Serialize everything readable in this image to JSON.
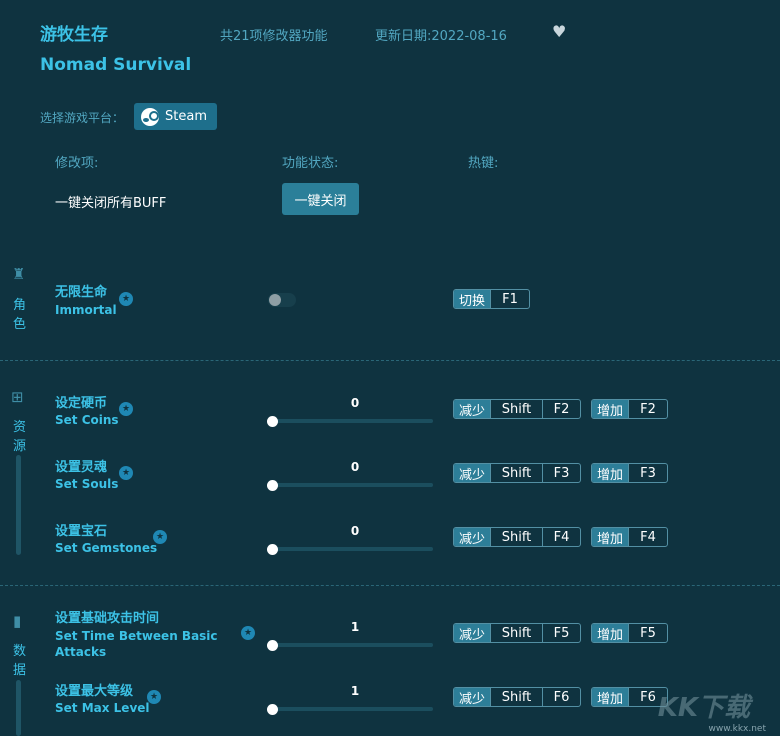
{
  "header": {
    "title_cn": "游牧生存",
    "title_en": "Nomad Survival",
    "feature_count": "共21项修改器功能",
    "update_date": "更新日期:2022-08-16",
    "heart": "♥"
  },
  "platform": {
    "label": "选择游戏平台：",
    "steam_label": "Steam"
  },
  "columns": {
    "option": "修改项:",
    "status": "功能状态:",
    "hotkey": "热键:"
  },
  "buff": {
    "label": "一键关闭所有BUFF",
    "button": "一键关闭"
  },
  "sections": {
    "role": {
      "icon": "♜",
      "char1": "角",
      "char2": "色"
    },
    "resource": {
      "icon": "⊞",
      "char1": "资",
      "char2": "源"
    },
    "data": {
      "icon": "▮",
      "char1": "数",
      "char2": "据"
    }
  },
  "options": {
    "immortal": {
      "cn": "无限生命",
      "en": "Immortal",
      "action": "切换",
      "key": "F1",
      "toggle_on": false
    },
    "coins": {
      "cn": "设定硬币",
      "en": "Set Coins",
      "value": "0",
      "dec": "减少",
      "mod": "Shift",
      "dec_key": "F2",
      "inc": "增加",
      "inc_key": "F2"
    },
    "souls": {
      "cn": "设置灵魂",
      "en": "Set Souls",
      "value": "0",
      "dec": "减少",
      "mod": "Shift",
      "dec_key": "F3",
      "inc": "增加",
      "inc_key": "F3"
    },
    "gems": {
      "cn": "设置宝石",
      "en": "Set Gemstones",
      "value": "0",
      "dec": "减少",
      "mod": "Shift",
      "dec_key": "F4",
      "inc": "增加",
      "inc_key": "F4"
    },
    "attack": {
      "cn": "设置基础攻击时间",
      "en1": "Set Time Between Basic",
      "en2": "Attacks",
      "value": "1",
      "dec": "减少",
      "mod": "Shift",
      "dec_key": "F5",
      "inc": "增加",
      "inc_key": "F5"
    },
    "level": {
      "cn": "设置最大等级",
      "en": "Set Max Level",
      "value": "1",
      "dec": "减少",
      "mod": "Shift",
      "dec_key": "F6",
      "inc": "增加",
      "inc_key": "F6"
    }
  },
  "watermark": {
    "logo": "KK下载",
    "url": "www.kkx.net"
  },
  "colors": {
    "background": "#0f3340",
    "accent": "#3cc2e6",
    "button": "#2b7f99"
  }
}
